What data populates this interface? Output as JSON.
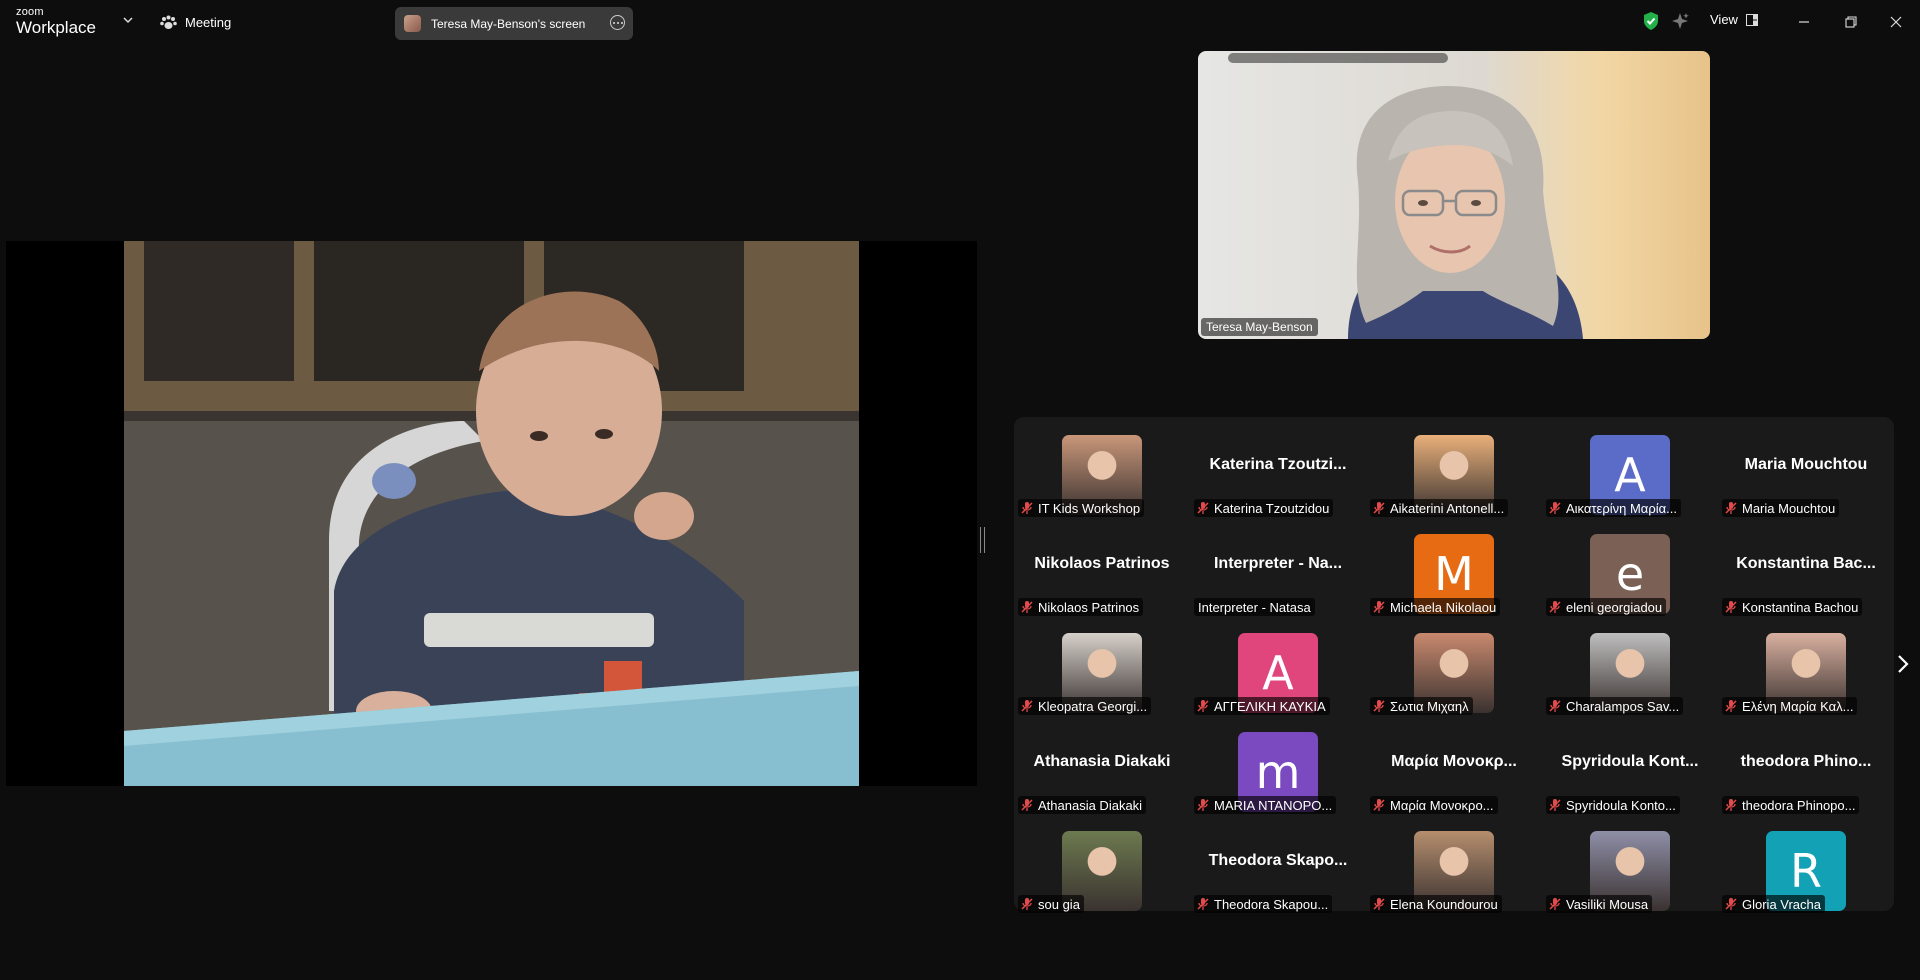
{
  "titlebar": {
    "logo_top": "zoom",
    "logo_bottom": "Workplace",
    "meeting_label": "Meeting",
    "share_label": "Teresa May-Benson's screen",
    "view_label": "View",
    "security_color": "#23b04a"
  },
  "speaker": {
    "name": "Teresa May-Benson"
  },
  "participants": [
    {
      "display": "photo",
      "big": "",
      "label": "IT Kids Workshop",
      "muted": true,
      "color": "#c9977a"
    },
    {
      "display": "name",
      "big": "Katerina  Tzoutzi...",
      "label": "Katerina Tzoutzidou",
      "muted": true
    },
    {
      "display": "photo",
      "big": "",
      "label": "Aikaterini Antonell...",
      "muted": true,
      "color": "#e9b07a"
    },
    {
      "display": "letter",
      "big": "A",
      "label": "Αικατερίνη Μαρία...",
      "muted": true,
      "color": "#5a6bc8"
    },
    {
      "display": "name",
      "big": "Maria Mouchtou",
      "label": "Maria Mouchtou",
      "muted": true
    },
    {
      "display": "name",
      "big": "Nikolaos Patrinos",
      "label": "Nikolaos Patrinos",
      "muted": true
    },
    {
      "display": "name",
      "big": "Interpreter - Na...",
      "label": "Interpreter - Natasa",
      "muted": false
    },
    {
      "display": "letter",
      "big": "M",
      "label": "Michaela Nikolaou",
      "muted": true,
      "color": "#e76b12"
    },
    {
      "display": "letter",
      "big": "e",
      "label": "eleni georgiadou",
      "muted": true,
      "color": "#7b6055"
    },
    {
      "display": "name",
      "big": "Konstantina  Bac...",
      "label": "Konstantina Bachou",
      "muted": true
    },
    {
      "display": "photo",
      "big": "",
      "label": "Kleopatra Georgi...",
      "muted": true,
      "color": "#d6d0cb"
    },
    {
      "display": "letter",
      "big": "A",
      "label": "ΑΓΓΕΛΙΚΗ ΚΑΥΚΙΑ",
      "muted": true,
      "color": "#e0457b"
    },
    {
      "display": "photo",
      "big": "",
      "label": "Σωτια Μιχαηλ",
      "muted": true,
      "color": "#c9896e"
    },
    {
      "display": "photo",
      "big": "",
      "label": "Charalampos Sav...",
      "muted": true,
      "color": "#bfbfbf"
    },
    {
      "display": "photo",
      "big": "",
      "label": "Ελένη Μαρία Καλ...",
      "muted": true,
      "color": "#d9b0a0"
    },
    {
      "display": "name",
      "big": "Athanasia Diakaki",
      "label": "Athanasia Diakaki",
      "muted": true
    },
    {
      "display": "letter",
      "big": "m",
      "label": "MARIA ΝΤΑΝΟΡΟ...",
      "muted": true,
      "color": "#7b49c0"
    },
    {
      "display": "name",
      "big": "Μαρία Μονοκρ...",
      "label": "Μαρία Μονοκρο...",
      "muted": true
    },
    {
      "display": "name",
      "big": "Spyridoula  Kont...",
      "label": "Spyridoula Konto...",
      "muted": true
    },
    {
      "display": "name",
      "big": "theodora  Phino...",
      "label": "theodora Phinopo...",
      "muted": true
    },
    {
      "display": "photo",
      "big": "",
      "label": "sou gia",
      "muted": true,
      "color": "#6d7a4f"
    },
    {
      "display": "name",
      "big": "Theodora  Skapo...",
      "label": "Theodora Skapou...",
      "muted": true
    },
    {
      "display": "photo",
      "big": "",
      "label": "Elena Koundourou",
      "muted": true,
      "color": "#b58e6e"
    },
    {
      "display": "photo",
      "big": "",
      "label": "Vasiliki Mousa",
      "muted": true,
      "color": "#8f8fa8"
    },
    {
      "display": "letter",
      "big": "R",
      "label": "Gloria Vracha",
      "muted": true,
      "color": "#13a1b5"
    }
  ]
}
